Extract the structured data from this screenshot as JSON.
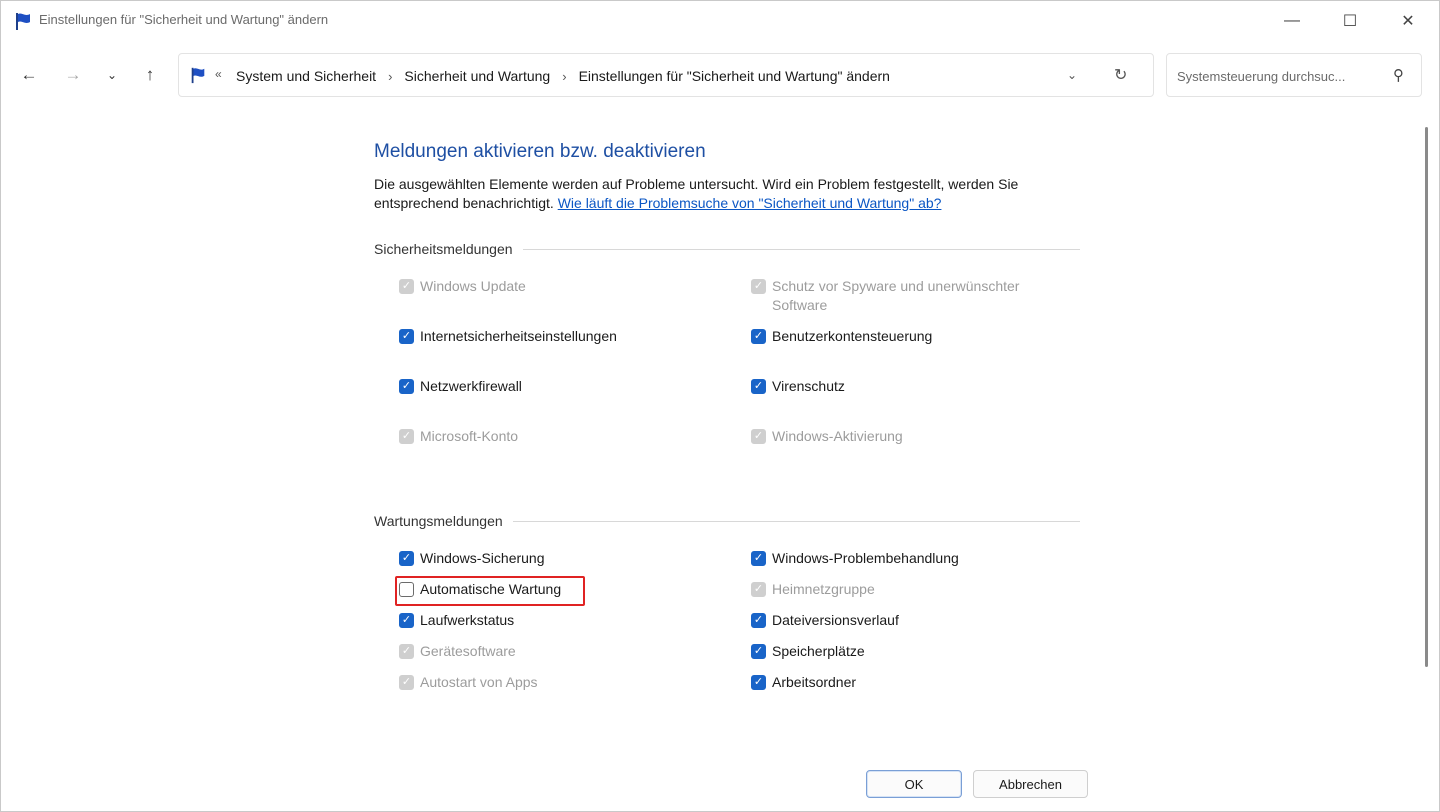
{
  "window": {
    "title": "Einstellungen für \"Sicherheit und Wartung\" ändern",
    "controls": {
      "minimize": "—",
      "maximize": "☐",
      "close": "✕"
    }
  },
  "nav": {
    "back_icon": "←",
    "forward_icon": "→",
    "recent_icon": "⌄",
    "up_icon": "↑"
  },
  "address": {
    "overflow": "«",
    "crumbs": [
      "System und Sicherheit",
      "Sicherheit und Wartung",
      "Einstellungen für \"Sicherheit und Wartung\" ändern"
    ],
    "separator": "›",
    "dropdown_icon": "⌄",
    "refresh_icon": "↻"
  },
  "search": {
    "placeholder": "Systemsteuerung durchsuc...",
    "icon": "⚲"
  },
  "main": {
    "heading": "Meldungen aktivieren bzw. deaktivieren",
    "description": "Die ausgewählten Elemente werden auf Probleme untersucht. Wird ein Problem festgestellt, werden Sie entsprechend benachrichtigt.",
    "help_link": "Wie läuft die Problemsuche von \"Sicherheit und Wartung\" ab?"
  },
  "security": {
    "title": "Sicherheitsmeldungen",
    "items": [
      {
        "label": "Windows Update",
        "state": "checked-disabled"
      },
      {
        "label": "Schutz vor Spyware und unerwünschter Software",
        "state": "checked-disabled"
      },
      {
        "label": "Internetsicherheitseinstellungen",
        "state": "checked"
      },
      {
        "label": "Benutzerkontensteuerung",
        "state": "checked"
      },
      {
        "label": "Netzwerkfirewall",
        "state": "checked"
      },
      {
        "label": "Virenschutz",
        "state": "checked"
      },
      {
        "label": "Microsoft-Konto",
        "state": "checked-disabled"
      },
      {
        "label": "Windows-Aktivierung",
        "state": "checked-disabled"
      }
    ]
  },
  "maintenance": {
    "title": "Wartungsmeldungen",
    "items": [
      {
        "label": "Windows-Sicherung",
        "state": "checked"
      },
      {
        "label": "Windows-Problembehandlung",
        "state": "checked"
      },
      {
        "label": "Automatische Wartung",
        "state": "unchecked"
      },
      {
        "label": "Heimnetzgruppe",
        "state": "checked-disabled"
      },
      {
        "label": "Laufwerkstatus",
        "state": "checked"
      },
      {
        "label": "Dateiversionsverlauf",
        "state": "checked"
      },
      {
        "label": "Gerätesoftware",
        "state": "checked-disabled"
      },
      {
        "label": "Speicherplätze",
        "state": "checked"
      },
      {
        "label": "Autostart von Apps",
        "state": "checked-disabled"
      },
      {
        "label": "Arbeitsordner",
        "state": "checked"
      }
    ]
  },
  "buttons": {
    "ok": "OK",
    "cancel": "Abbrechen"
  },
  "colors": {
    "accent": "#1964c8",
    "heading": "#1e4fa3",
    "link": "#0b56c4",
    "highlight": "#e02323"
  }
}
